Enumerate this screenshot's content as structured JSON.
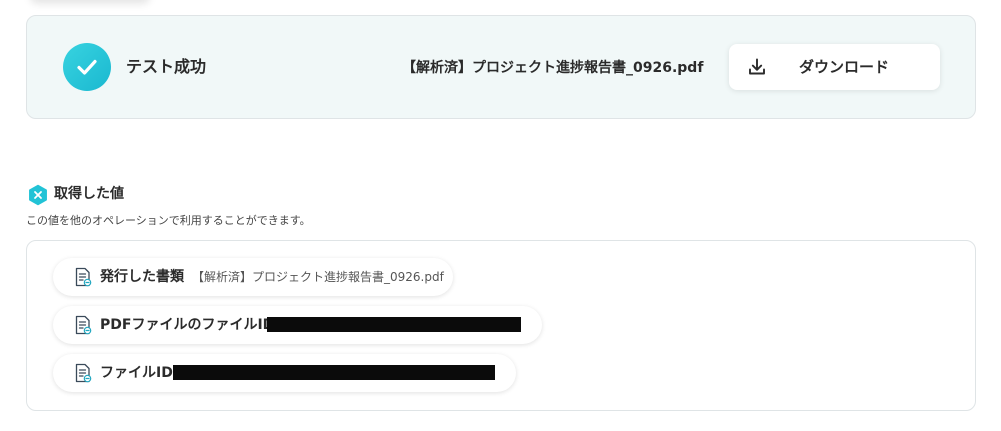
{
  "result": {
    "status_title": "テスト成功",
    "file_name": "【解析済】プロジェクト進捗報告書_0926.pdf",
    "download_label": "ダウンロード",
    "accent_color": "#22c3d6",
    "icons": {
      "status": "check-circle-icon",
      "download": "download-icon"
    }
  },
  "values_section": {
    "title": "取得した値",
    "description": "この値を他のオペレーションで利用することができます。",
    "icon": "variable-icon",
    "items": [
      {
        "label": "発行した書類",
        "value": "【解析済】プロジェクト進捗報告書_0926.pdf",
        "icon": "document-icon"
      },
      {
        "label": "PDFファイルのファイルID",
        "value": "",
        "redacted": true,
        "icon": "document-icon"
      },
      {
        "label": "ファイルID",
        "value": "",
        "redacted": true,
        "icon": "document-icon"
      }
    ]
  }
}
